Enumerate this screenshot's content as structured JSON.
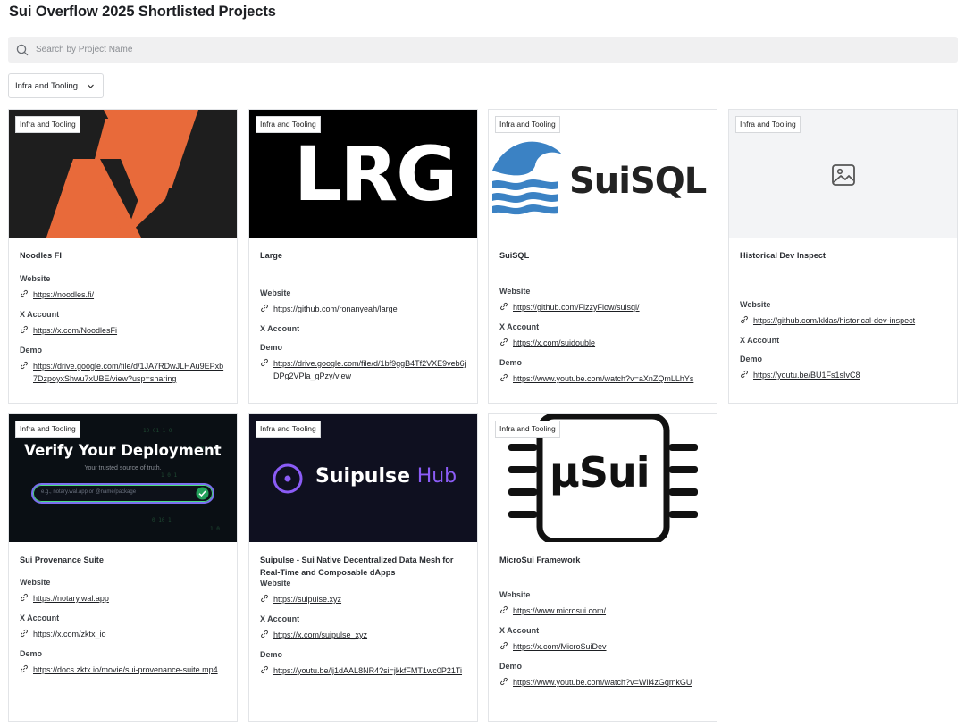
{
  "page": {
    "title": "Sui Overflow 2025 Shortlisted Projects"
  },
  "search": {
    "placeholder": "Search by Project Name"
  },
  "filter": {
    "selected": "Infra and Tooling"
  },
  "projects": [
    {
      "category": "Infra and Tooling",
      "title": "Noodles FI",
      "website_label": "Website",
      "website": "https://noodles.fi/",
      "x_label": "X Account",
      "x": "https://x.com/NoodlesFi",
      "demo_label": "Demo",
      "demo": "https://drive.google.com/file/d/1JA7RDwJLHAu9EPxb7DzpoyxShwu7xUBE/view?usp=sharing",
      "image": {
        "logo": "noodles-logo",
        "bg": "#1e1e1e",
        "accent": "#e86a3a"
      }
    },
    {
      "category": "Infra and Tooling",
      "title": "Large",
      "website_label": "Website",
      "website": "https://github.com/ronanyeah/large",
      "x_label": "X Account",
      "demo_label": "Demo",
      "demo": "https://drive.google.com/file/d/1bf9ggB4Tf2VXE9veb6jDPg2VPla_gPzy/view",
      "image": {
        "logo_text": "LRG",
        "bg": "#000000"
      }
    },
    {
      "category": "Infra and Tooling",
      "title": "SuiSQL",
      "website_label": "Website",
      "website": "https://github.com/FizzyFlow/suisql/",
      "x_label": "X Account",
      "x": "https://x.com/suidouble",
      "demo_label": "Demo",
      "demo": "https://www.youtube.com/watch?v=aXnZQmLLhYs",
      "image": {
        "logo_text": "SuiSQL",
        "accent": "#3b82c4"
      }
    },
    {
      "category": "Infra and Tooling",
      "title": "Historical Dev Inspect",
      "website_label": "Website",
      "website": "https://github.com/kklas/historical-dev-inspect",
      "x_label": "X Account",
      "demo_label": "Demo",
      "demo": "https://youtu.be/BU1Fs1sIvC8",
      "image": {
        "logo": "image-placeholder-icon",
        "bg": "#f3f4f6"
      }
    },
    {
      "category": "Infra and Tooling",
      "title": "Sui Provenance Suite",
      "website_label": "Website",
      "website": "https://notary.wal.app",
      "x_label": "X Account",
      "x": "https://x.com/zktx_io",
      "demo_label": "Demo",
      "demo": "https://docs.zktx.io/movie/sui-provenance-suite.mp4",
      "image": {
        "headline": "Verify Your Deployment",
        "subline": "Your trusted source of truth.",
        "input_placeholder": "e.g., notary.wal.app or @name/package",
        "bg": "#0a0f14",
        "accent": "#7b6ff0"
      }
    },
    {
      "category": "Infra and Tooling",
      "title": "Suipulse - Sui Native Decentralized Data Mesh for Real-Time and Composable dApps",
      "website_label": "Website",
      "website": "https://suipulse.xyz",
      "x_label": "X Account",
      "x": "https://x.com/suipulse_xyz",
      "demo_label": "Demo",
      "demo": "https://youtu.be/lj1dAAL8NR4?si=jkkfFMT1wc0P21Ti",
      "image": {
        "brand": "Suipulse",
        "brand_suffix": "Hub",
        "bg": "#0f1020",
        "accent": "#8b5cf6"
      }
    },
    {
      "category": "Infra and Tooling",
      "title": "MicroSui Framework",
      "website_label": "Website",
      "website": "https://www.microsui.com/",
      "x_label": "X Account",
      "x": "https://x.com/MicroSuiDev",
      "demo_label": "Demo",
      "demo": "https://www.youtube.com/watch?v=Wil4zGqmkGU",
      "image": {
        "logo_text": "μSui",
        "bg": "#ffffff"
      }
    }
  ]
}
